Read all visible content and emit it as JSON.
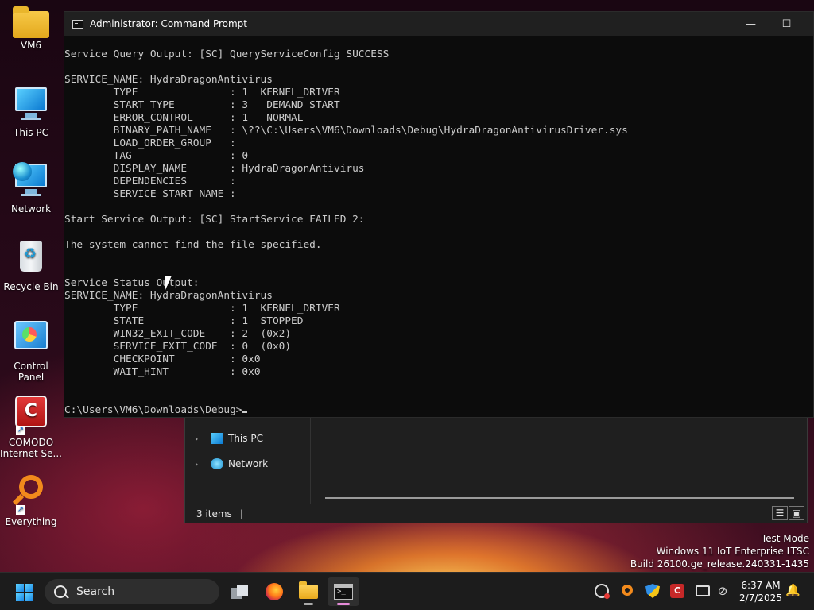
{
  "desktop": {
    "icons": [
      {
        "label": "VM6",
        "icon": "folder-icon"
      },
      {
        "label": "This PC",
        "icon": "computer-icon"
      },
      {
        "label": "Network",
        "icon": "network-icon"
      },
      {
        "label": "Recycle Bin",
        "icon": "recycle-bin-icon"
      },
      {
        "label": "Control Panel",
        "icon": "control-panel-icon"
      },
      {
        "label": "COMODO\nInternet Se...",
        "icon": "comodo-icon"
      },
      {
        "label": "Everything",
        "icon": "everything-icon"
      }
    ]
  },
  "cmd": {
    "title": "Administrator: Command Prompt",
    "minimize_glyph": "—",
    "maximize_glyph": "☐",
    "lines": [
      "Service Query Output: [SC] QueryServiceConfig SUCCESS",
      "",
      "SERVICE_NAME: HydraDragonAntivirus",
      "        TYPE               : 1  KERNEL_DRIVER",
      "        START_TYPE         : 3   DEMAND_START",
      "        ERROR_CONTROL      : 1   NORMAL",
      "        BINARY_PATH_NAME   : \\??\\C:\\Users\\VM6\\Downloads\\Debug\\HydraDragonAntivirusDriver.sys",
      "        LOAD_ORDER_GROUP   :",
      "        TAG                : 0",
      "        DISPLAY_NAME       : HydraDragonAntivirus",
      "        DEPENDENCIES       :",
      "        SERVICE_START_NAME :",
      "",
      "Start Service Output: [SC] StartService FAILED 2:",
      "",
      "The system cannot find the file specified.",
      "",
      "",
      "Service Status Output:",
      "SERVICE_NAME: HydraDragonAntivirus",
      "        TYPE               : 1  KERNEL_DRIVER",
      "        STATE              : 1  STOPPED",
      "        WIN32_EXIT_CODE    : 2  (0x2)",
      "        SERVICE_EXIT_CODE  : 0  (0x0)",
      "        CHECKPOINT         : 0x0",
      "        WAIT_HINT          : 0x0",
      "",
      "",
      "C:\\Users\\VM6\\Downloads\\Debug>"
    ]
  },
  "explorer": {
    "nav_items": [
      {
        "label": "This PC",
        "icon": "computer-icon"
      },
      {
        "label": "Network",
        "icon": "network-icon"
      }
    ],
    "status": "3 items",
    "status_sep": "|"
  },
  "watermark": {
    "line1": "Test Mode",
    "line2": "Windows 11 IoT Enterprise LTSC",
    "line3": "Build 26100.ge_release.240331-1435"
  },
  "taskbar": {
    "search_label": "Search",
    "apps": [
      "task-view-icon",
      "firefox-icon",
      "file-explorer-icon",
      "command-prompt-icon"
    ],
    "tray": [
      "sync-icon",
      "everything-icon",
      "defender-shield-icon",
      "comodo-icon",
      "display-icon",
      "speaker-muted-icon"
    ],
    "time": "6:37 AM",
    "date": "2/7/2025"
  }
}
